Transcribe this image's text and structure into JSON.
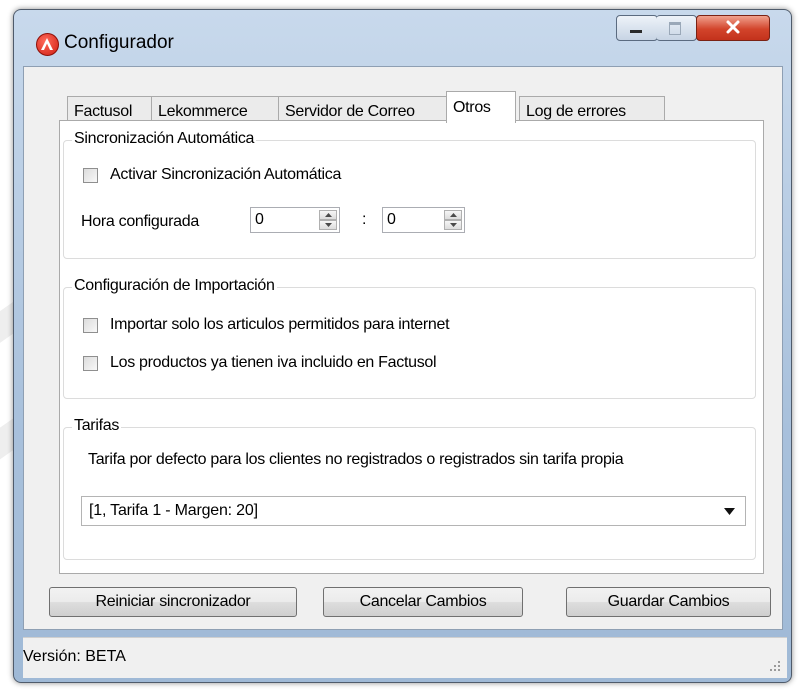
{
  "window": {
    "title": "Configurador"
  },
  "tabs": [
    {
      "label": "Factusol",
      "active": false
    },
    {
      "label": "Lekommerce",
      "active": false
    },
    {
      "label": "Servidor de Correo",
      "active": false
    },
    {
      "label": "Otros",
      "active": true
    },
    {
      "label": "Log de errores",
      "active": false
    }
  ],
  "sync": {
    "group_title": "Sincronización Automática",
    "activate_label": "Activar Sincronización Automática",
    "activate_checked": false,
    "hour_label": "Hora configurada",
    "hour_value": "0",
    "separator": ":",
    "minute_value": "0"
  },
  "import": {
    "group_title": "Configuración de Importación",
    "only_internet_label": "Importar solo los articulos permitidos para internet",
    "only_internet_checked": false,
    "iva_included_label": "Los productos ya tienen iva incluido en Factusol",
    "iva_included_checked": false
  },
  "tariffs": {
    "group_title": "Tarifas",
    "description": "Tarifa por defecto para los clientes no registrados o registrados sin tarifa propia",
    "selected": "[1, Tarifa 1 - Margen: 20]"
  },
  "buttons": {
    "restart": "Reiniciar sincronizador",
    "cancel": "Cancelar Cambios",
    "save": "Guardar Cambios"
  },
  "status": {
    "version_text": "Versión: BETA"
  },
  "icons": {
    "app": "app-logo-icon",
    "minimize": "minimize-icon",
    "maximize": "maximize-icon",
    "close": "close-icon",
    "spin_up": "spin-up-icon",
    "spin_down": "spin-down-icon",
    "dropdown": "chevron-down-icon",
    "grip": "resize-grip-icon"
  },
  "colors": {
    "close_button": "#c3321c",
    "title_gradient": "#a9c1dc"
  }
}
